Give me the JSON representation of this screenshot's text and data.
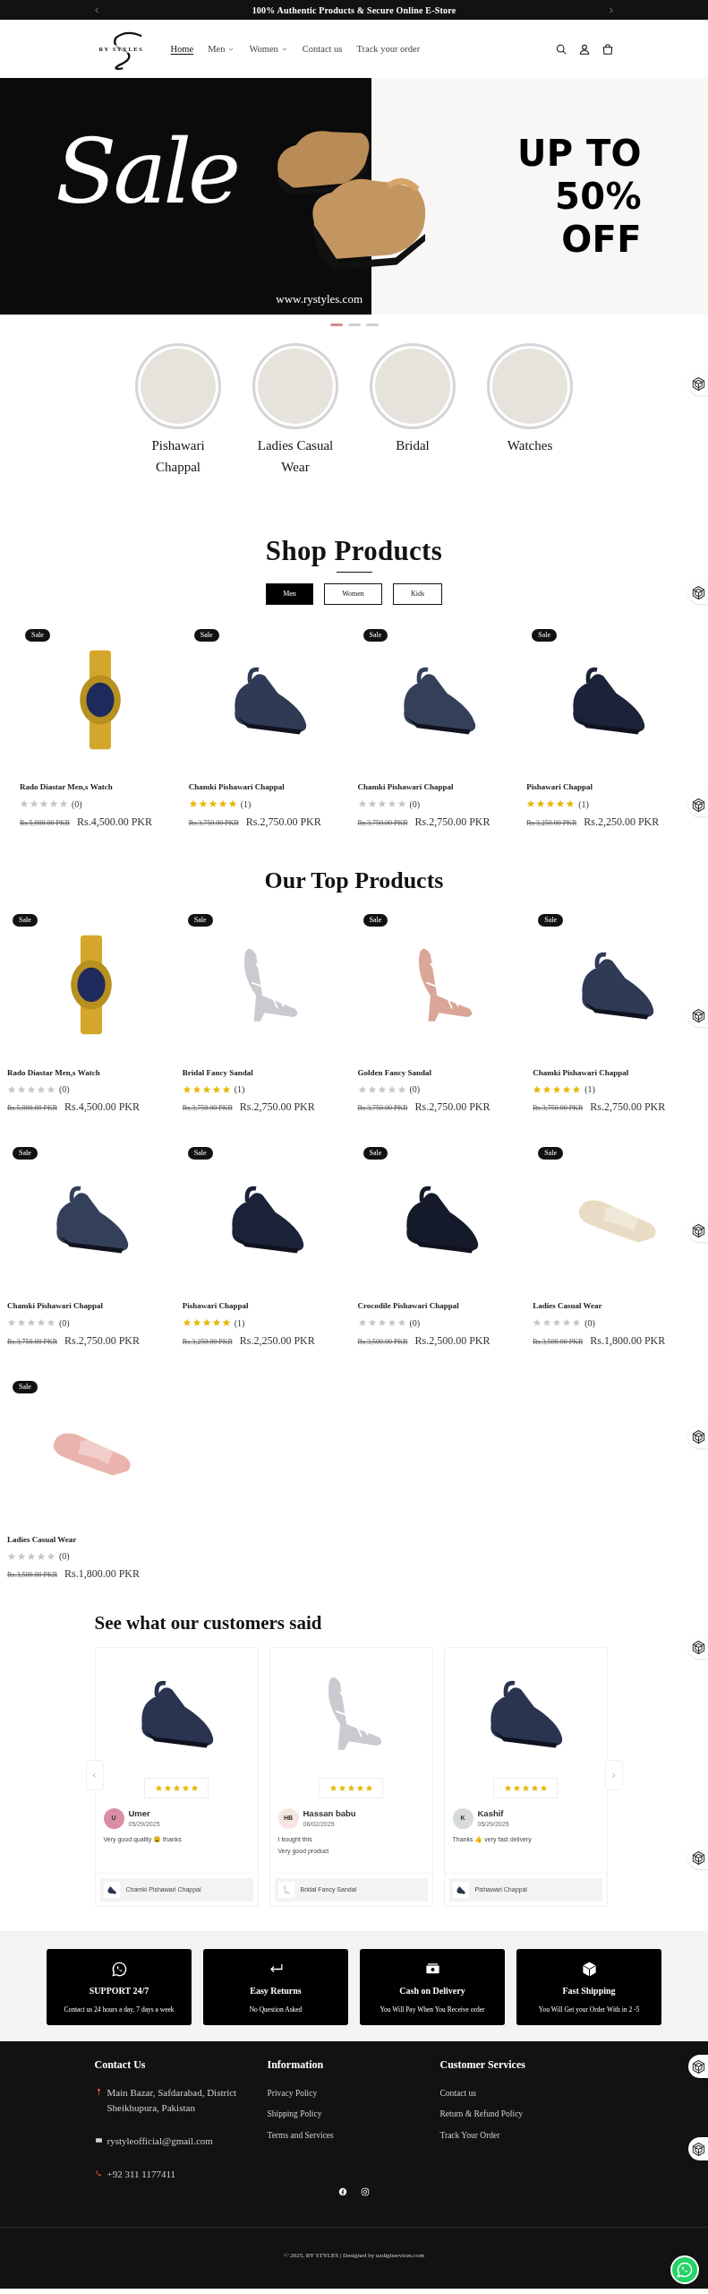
{
  "announcement": {
    "text": "100% Authentic Products & Secure Online E-Store"
  },
  "header": {
    "logo": "RY STYLES",
    "nav": [
      {
        "label": "Home",
        "selected": true,
        "dropdown": false
      },
      {
        "label": "Men",
        "selected": false,
        "dropdown": true
      },
      {
        "label": "Women",
        "selected": false,
        "dropdown": true
      },
      {
        "label": "Contact us",
        "selected": false,
        "dropdown": false
      },
      {
        "label": "Track your order",
        "selected": false,
        "dropdown": false
      }
    ]
  },
  "banner": {
    "script": "Sale",
    "headline": [
      "UP TO",
      "50%",
      "OFF"
    ],
    "website": "www.rystyles.com"
  },
  "slider_dots": [
    {
      "selected": true
    },
    {
      "selected": false
    },
    {
      "selected": false
    }
  ],
  "categories": [
    {
      "label": "Pishawari Chappal"
    },
    {
      "label": "Ladies Casual Wear"
    },
    {
      "label": "Bridal"
    },
    {
      "label": "Watches"
    }
  ],
  "shop_products": {
    "title": "Shop Products",
    "tabs": [
      {
        "label": "Men",
        "selected": true
      },
      {
        "label": "Women",
        "selected": false
      },
      {
        "label": "Kids",
        "selected": false
      }
    ],
    "products": [
      {
        "badge": "Sale",
        "kind": "watch",
        "color": "#d4a72c",
        "name": "Rado Diastar Men,s Watch",
        "stars": 0,
        "reviews": "(0)",
        "compare_price": "Rs.5,000.00 PKR",
        "price": "Rs.4,500.00 PKR"
      },
      {
        "badge": "Sale",
        "kind": "chappal",
        "color": "#2f3b55",
        "name": "Chamki Pishawari Chappal",
        "stars": 5,
        "reviews": "(1)",
        "compare_price": "Rs.3,750.00 PKR",
        "price": "Rs.2,750.00 PKR"
      },
      {
        "badge": "Sale",
        "kind": "chappal",
        "color": "#344059",
        "name": "Chamki Pishawari Chappal",
        "stars": 0,
        "reviews": "(0)",
        "compare_price": "Rs.3,750.00 PKR",
        "price": "Rs.2,750.00 PKR"
      },
      {
        "badge": "Sale",
        "kind": "chappal",
        "color": "#1c2238",
        "name": "Pishawari Chappal",
        "stars": 5,
        "reviews": "(1)",
        "compare_price": "Rs.3,250.00 PKR",
        "price": "Rs.2,250.00 PKR"
      }
    ]
  },
  "top_products": {
    "title": "Our Top Products",
    "products": [
      {
        "badge": "Sale",
        "kind": "watch",
        "color": "#d4a72c",
        "name": "Rado Diastar Men,s Watch",
        "stars": 0,
        "reviews": "(0)",
        "compare_price": "Rs.5,000.00 PKR",
        "price": "Rs.4,500.00 PKR"
      },
      {
        "badge": "Sale",
        "kind": "heel",
        "color": "#c9cbd0",
        "name": "Bridal Fancy Sandal",
        "stars": 5,
        "reviews": "(1)",
        "compare_price": "Rs.3,750.00 PKR",
        "price": "Rs.2,750.00 PKR"
      },
      {
        "badge": "Sale",
        "kind": "heel",
        "color": "#d9a698",
        "name": "Golden Fancy Sandal",
        "stars": 0,
        "reviews": "(0)",
        "compare_price": "Rs.3,750.00 PKR",
        "price": "Rs.2,750.00 PKR"
      },
      {
        "badge": "Sale",
        "kind": "chappal",
        "color": "#2f3b55",
        "name": "Chamki Pishawari Chappal",
        "stars": 5,
        "reviews": "(1)",
        "compare_price": "Rs.3,750.00 PKR",
        "price": "Rs.2,750.00 PKR"
      },
      {
        "badge": "Sale",
        "kind": "chappal",
        "color": "#344059",
        "name": "Chamki Pishawari Chappal",
        "stars": 0,
        "reviews": "(0)",
        "compare_price": "Rs.3,750.00 PKR",
        "price": "Rs.2,750.00 PKR"
      },
      {
        "badge": "Sale",
        "kind": "chappal",
        "color": "#1c2238",
        "name": "Pishawari Chappal",
        "stars": 5,
        "reviews": "(1)",
        "compare_price": "Rs.3,250.00 PKR",
        "price": "Rs.2,250.00 PKR"
      },
      {
        "badge": "Sale",
        "kind": "chappal",
        "color": "#151a2b",
        "name": "Crocodile Pishawari Chappal",
        "stars": 0,
        "reviews": "(0)",
        "compare_price": "Rs.3,500.00 PKR",
        "price": "Rs.2,500.00 PKR"
      },
      {
        "badge": "Sale",
        "kind": "slide",
        "color": "#e8dcc4",
        "name": "Ladies Casual Wear",
        "stars": 0,
        "reviews": "(0)",
        "compare_price": "Rs.3,500.00 PKR",
        "price": "Rs.1,800.00 PKR"
      },
      {
        "badge": "Sale",
        "kind": "slide",
        "color": "#eab3ae",
        "name": "Ladies Casual Wear",
        "stars": 0,
        "reviews": "(0)",
        "compare_price": "Rs.3,500.00 PKR",
        "price": "Rs.1,800.00 PKR"
      }
    ]
  },
  "reviews": {
    "title": "See what our customers said",
    "cards": [
      {
        "kind": "chappal",
        "stars": 5,
        "initials": "U",
        "color": "#d98ea3",
        "name": "Umer",
        "date": "05/29/2025",
        "text": [
          "Very good quality 😩 thanks"
        ],
        "product": "Chamki Pishawari Chappal"
      },
      {
        "kind": "heel",
        "stars": 5,
        "initials": "HB",
        "color": "#f5e6e1",
        "name": "Hassan babu",
        "date": "06/02/2025",
        "text": [
          "I bought this",
          "Very good product"
        ],
        "product": "Bridal Fancy Sandal"
      },
      {
        "kind": "chappal",
        "stars": 5,
        "initials": "K",
        "color": "#d6dada",
        "name": "Kashif",
        "date": "05/29/2025",
        "text": [
          "Thanks 👍 very fast delivery"
        ],
        "product": "Pishawari Chappal"
      }
    ]
  },
  "features": [
    {
      "kind": "support",
      "title": "SUPPORT 24/7",
      "text": "Contact us 24 hours a day, 7 days a week"
    },
    {
      "kind": "returns",
      "title": "Easy Returns",
      "text": "No Question Asked"
    },
    {
      "kind": "cash",
      "title": "Cash on Delivery",
      "text": "You Will Pay When You Receive order"
    },
    {
      "kind": "shipping",
      "title": "Fast Shipping",
      "text": "You Will Get your Order With in 2 -5"
    }
  ],
  "footer": {
    "contact": {
      "title": "Contact Us",
      "items": [
        {
          "kind": "address",
          "text": "Main Bazar, Safdarabad, District Sheikhupura, Pakistan"
        },
        {
          "kind": "email",
          "text": "rystyleofficial@gmail.com"
        },
        {
          "kind": "phone",
          "text": "+92 311 1177411"
        }
      ]
    },
    "information": {
      "title": "Information",
      "links": [
        "Privacy Policy",
        "Shipping Policy",
        "Terms and Services"
      ]
    },
    "customer_services": {
      "title": "Customer Services",
      "links": [
        "Contact us",
        "Return & Refund Policy",
        "Track Your Order"
      ]
    },
    "copyright": "© 2025, RY STYLES | Designed by uadigiservices.com"
  }
}
